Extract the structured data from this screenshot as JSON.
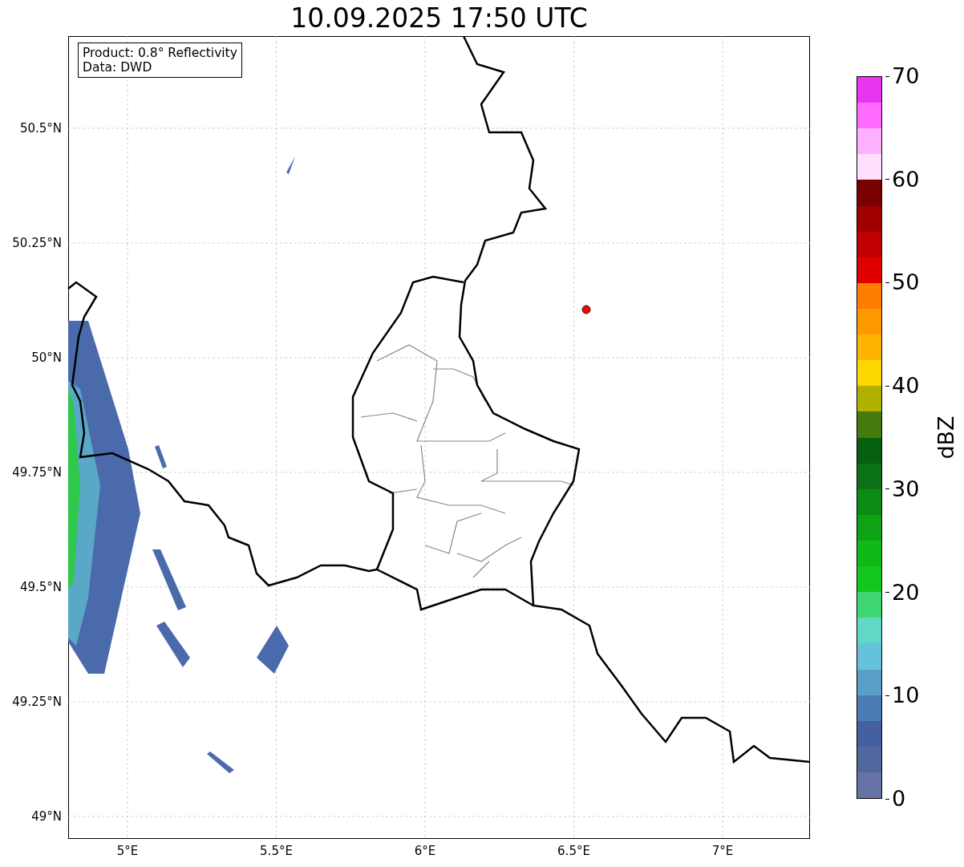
{
  "title": "10.09.2025 17:50 UTC",
  "info_box": [
    "Product: 0.8° Reflectivity",
    "Data: DWD"
  ],
  "map": {
    "lat_ticks": [
      "50.5°N",
      "50.25°N",
      "50°N",
      "49.75°N",
      "49.5°N",
      "49.25°N",
      "49°N"
    ],
    "lon_ticks": [
      "5°E",
      "5.5°E",
      "6°E",
      "6.5°E",
      "7°E"
    ]
  },
  "colorbar": {
    "label": "dBZ",
    "ticks": [
      "70",
      "60",
      "50",
      "40",
      "30",
      "20",
      "10",
      "0"
    ],
    "bins": [
      {
        "color": "#e935ef"
      },
      {
        "color": "#ff6cff"
      },
      {
        "color": "#ffb0ff"
      },
      {
        "color": "#ffe0ff"
      },
      {
        "color": "#780000"
      },
      {
        "color": "#a00000"
      },
      {
        "color": "#c00000"
      },
      {
        "color": "#e10000"
      },
      {
        "color": "#ff7e00"
      },
      {
        "color": "#ff9900"
      },
      {
        "color": "#ffb400"
      },
      {
        "color": "#ffd700"
      },
      {
        "color": "#afb000"
      },
      {
        "color": "#457a0d"
      },
      {
        "color": "#075f10"
      },
      {
        "color": "#0a7214"
      },
      {
        "color": "#0b8a14"
      },
      {
        "color": "#0ea314"
      },
      {
        "color": "#10b818"
      },
      {
        "color": "#12c81e"
      },
      {
        "color": "#3dd672"
      },
      {
        "color": "#60d8c8"
      },
      {
        "color": "#66c2dc"
      },
      {
        "color": "#5a9fc8"
      },
      {
        "color": "#4a7db5"
      },
      {
        "color": "#4460a0"
      },
      {
        "color": "#52679e"
      },
      {
        "color": "#6673a6"
      }
    ]
  }
}
